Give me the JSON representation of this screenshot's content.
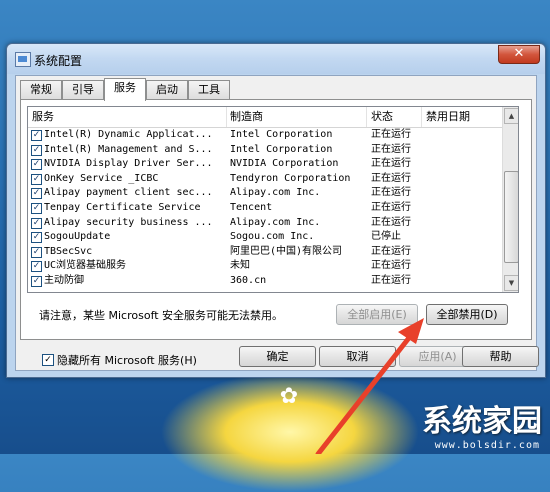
{
  "window": {
    "title": "系统配置",
    "close": "✕"
  },
  "tabs": [
    {
      "label": "常规"
    },
    {
      "label": "引导"
    },
    {
      "label": "服务",
      "active": true
    },
    {
      "label": "启动"
    },
    {
      "label": "工具"
    }
  ],
  "columns": [
    "服务",
    "制造商",
    "状态",
    "禁用日期"
  ],
  "rows": [
    {
      "name": "Intel(R) Dynamic Applicat...",
      "manufacturer": "Intel Corporation",
      "status": "正在运行",
      "checked": true
    },
    {
      "name": "Intel(R) Management and S...",
      "manufacturer": "Intel Corporation",
      "status": "正在运行",
      "checked": true
    },
    {
      "name": "NVIDIA Display Driver Ser...",
      "manufacturer": "NVIDIA Corporation",
      "status": "正在运行",
      "checked": true
    },
    {
      "name": "OnKey Service _ICBC",
      "manufacturer": "Tendyron Corporation",
      "status": "正在运行",
      "checked": true
    },
    {
      "name": "Alipay payment client sec...",
      "manufacturer": "Alipay.com Inc.",
      "status": "正在运行",
      "checked": true
    },
    {
      "name": "Tenpay Certificate Service",
      "manufacturer": "Tencent",
      "status": "正在运行",
      "checked": true
    },
    {
      "name": "Alipay security business ...",
      "manufacturer": "Alipay.com Inc.",
      "status": "正在运行",
      "checked": true
    },
    {
      "name": "SogouUpdate",
      "manufacturer": "Sogou.com Inc.",
      "status": "已停止",
      "checked": true
    },
    {
      "name": "TBSecSvc",
      "manufacturer": "阿里巴巴(中国)有限公司",
      "status": "正在运行",
      "checked": true
    },
    {
      "name": "UC浏览器基础服务",
      "manufacturer": "未知",
      "status": "正在运行",
      "checked": true
    },
    {
      "name": "主动防御",
      "manufacturer": "360.cn",
      "status": "正在运行",
      "checked": true
    }
  ],
  "note": "请注意，某些 Microsoft 安全服务可能无法禁用。",
  "buttons": {
    "enable_all": "全部启用(E)",
    "disable_all": "全部禁用(D)",
    "ok": "确定",
    "cancel": "取消",
    "apply": "应用(A)",
    "help": "帮助"
  },
  "hide_ms": {
    "label": "隐藏所有 Microsoft 服务(H)",
    "checked": true
  },
  "watermark": {
    "text": "系统家园",
    "url": "www.bolsdir.com"
  },
  "colors": {
    "desktop": "#2a72b4",
    "arrow": "#e8402a"
  }
}
